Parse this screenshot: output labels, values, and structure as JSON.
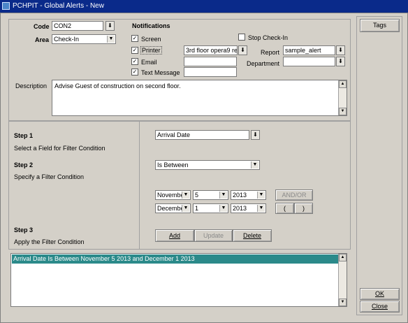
{
  "window": {
    "title": "PCHPIT - Global Alerts - New"
  },
  "form": {
    "code_label": "Code",
    "code_value": "CON2",
    "area_label": "Area",
    "area_value": "Check-In",
    "description_label": "Description",
    "description_value": "Advise Guest of construction on second floor."
  },
  "notifications": {
    "heading": "Notifications",
    "screen": {
      "label": "Screen",
      "checked": true
    },
    "printer": {
      "label": "Printer",
      "checked": true,
      "value": "3rd floor opera9 re"
    },
    "email": {
      "label": "Email",
      "checked": true,
      "value": ""
    },
    "text_message": {
      "label": "Text Message",
      "checked": true,
      "value": ""
    },
    "stop_checkin": {
      "label": "Stop Check-In",
      "checked": false
    },
    "report_label": "Report",
    "report_value": "sample_alert",
    "department_label": "Department",
    "department_value": ""
  },
  "steps": {
    "step1_title": "Step 1",
    "step1_desc": "Select a Field for Filter Condition",
    "step2_title": "Step 2",
    "step2_desc": "Specify a Filter Condition",
    "step3_title": "Step 3",
    "step3_desc": "Apply the Filter Condition"
  },
  "filter": {
    "field_value": "Arrival Date",
    "condition_value": "Is Between",
    "from_month": "November",
    "from_day": "5",
    "from_year": "2013",
    "to_month": "December",
    "to_day": "1",
    "to_year": "2013",
    "andor_label": "AND/OR",
    "open_paren": "(",
    "close_paren": ")"
  },
  "actions": {
    "add": "Add",
    "update": "Update",
    "delete": "Delete"
  },
  "conditions_list": [
    "Arrival Date Is Between November 5 2013 and December 1 2013"
  ],
  "side_buttons": {
    "tags": "Tags",
    "ok": "OK",
    "close": "Close"
  },
  "colors": {
    "title_bar": "#0a2a8a",
    "selected_row": "#2b8a8a",
    "window_bg": "#d4d0c8"
  }
}
